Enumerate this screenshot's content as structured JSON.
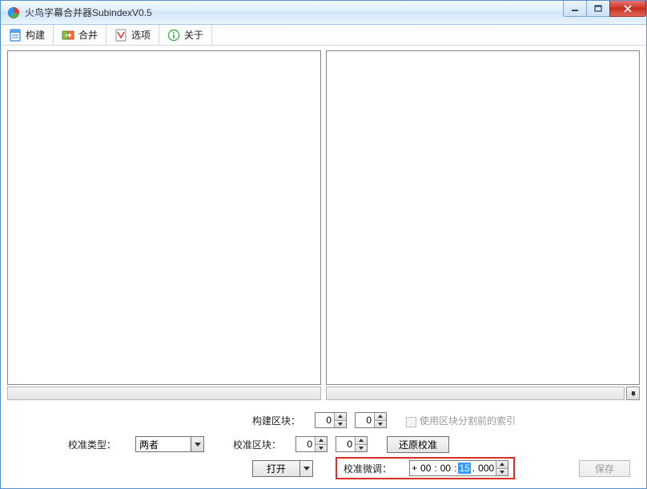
{
  "window": {
    "title": "火鸟字幕合并器SubindexV0.5"
  },
  "toolbar": {
    "build": "构建",
    "merge": "合并",
    "options": "选项",
    "about": "关于"
  },
  "controls": {
    "build_block_label": "构建区块：",
    "build_block_a": "0",
    "build_block_b": "0",
    "use_presplit_index_label": "使用区块分割前的索引",
    "use_presplit_index_checked": false,
    "calib_type_label": "校准类型：",
    "calib_type_value": "两者",
    "calib_block_label": "校准区块：",
    "calib_block_a": "0",
    "calib_block_b": "0",
    "restore_calib": "还原校准",
    "open": "打开",
    "fine_tune_label": "校准微调：",
    "time_sign": "+",
    "time_h": "00",
    "time_m": "00",
    "time_s_sel": "15",
    "time_ms": "000",
    "save": "保存"
  }
}
